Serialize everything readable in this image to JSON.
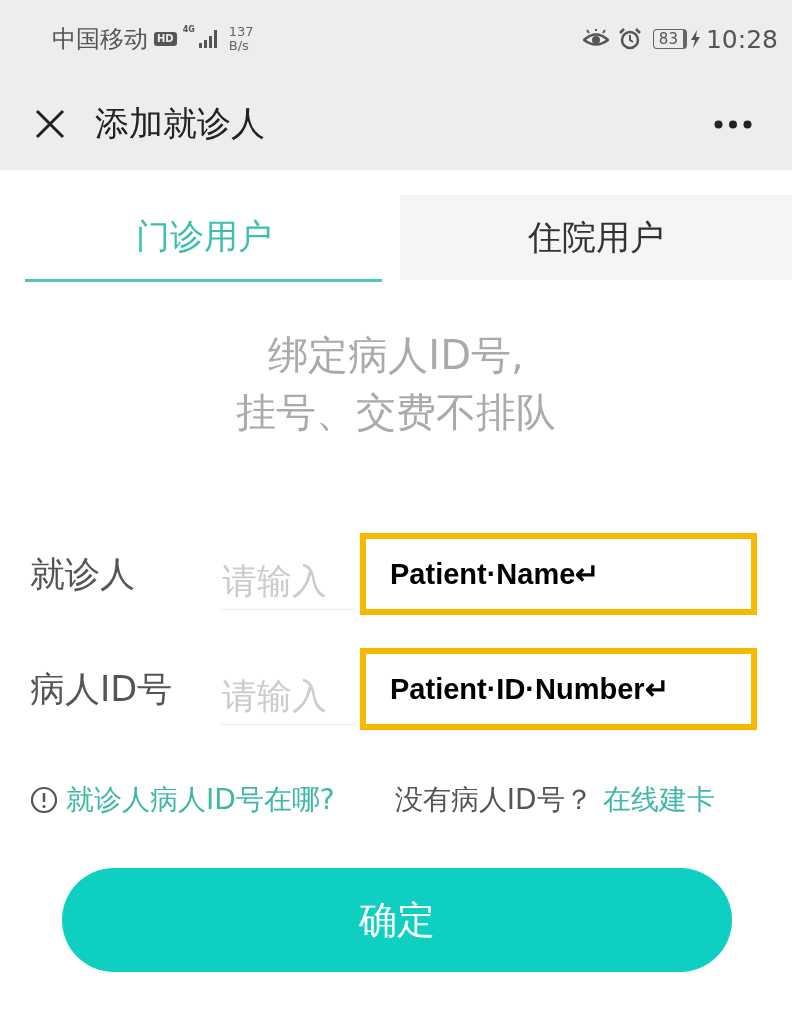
{
  "status_bar": {
    "carrier": "中国移动",
    "hd_badge": "HD",
    "network_type": "4G",
    "network_speed": "137",
    "network_speed_unit": "B/s",
    "battery": "83",
    "time": "10:28"
  },
  "header": {
    "title": "添加就诊人"
  },
  "tabs": [
    {
      "label": "门诊用户",
      "selected": true
    },
    {
      "label": "住院用户",
      "selected": false
    }
  ],
  "intro": [
    "绑定病人ID号,",
    "挂号、交费不排队"
  ],
  "form": {
    "fields": [
      {
        "label": "就诊人",
        "placeholder": "请输入",
        "annotation": "Patient·Name↵"
      },
      {
        "label": "病人ID号",
        "placeholder": "请输入",
        "annotation": "Patient·ID·Number↵"
      }
    ]
  },
  "help": {
    "link": "就诊人病人ID号在哪?",
    "no_id_text": "没有病人ID号？",
    "create_card_link": "在线建卡"
  },
  "confirm_button": "确定"
}
